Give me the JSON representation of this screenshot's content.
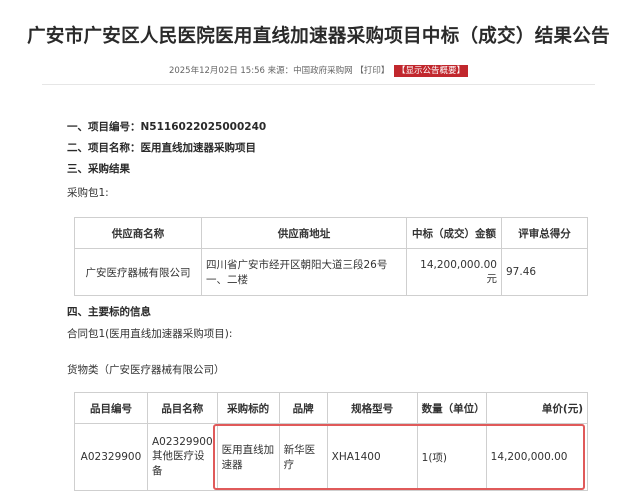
{
  "title": "广安市广安区人民医院医用直线加速器采购项目中标（成交）结果公告",
  "meta": {
    "datetime": "2025年12月02日 15:56",
    "source": "来源：中国政府采购网",
    "print": "【打印】",
    "badge": "【显示公告概要】"
  },
  "sections": {
    "project_no": "一、项目编号：N5116022025000240",
    "project_name": "二、项目名称：医用直线加速器采购项目",
    "result": "三、采购结果",
    "package": "采购包1:",
    "subject_info": "四、主要标的信息",
    "contract_pkg": "合同包1(医用直线加速器采购项目):",
    "goods_class": "货物类（广安医疗器械有限公司）"
  },
  "result_table": {
    "headers": [
      "供应商名称",
      "供应商地址",
      "中标（成交）金额",
      "评审总得分"
    ],
    "row": [
      "广安医疗器械有限公司",
      "四川省广安市经开区朝阳大道三段26号一、二楼",
      "14,200,000.00元",
      "97.46"
    ]
  },
  "goods_table": {
    "headers": [
      "品目编号",
      "品目名称",
      "采购标的",
      "品牌",
      "规格型号",
      "数量（单位）",
      "单价(元)"
    ],
    "row": [
      "A02329900",
      "A02329900其他医疗设备",
      "医用直线加速器",
      "新华医疗",
      "XHA1400",
      "1(项)",
      "14,200,000.00"
    ]
  },
  "colors": {
    "badge": "#c1272d",
    "highlight": "#e05a5a"
  }
}
